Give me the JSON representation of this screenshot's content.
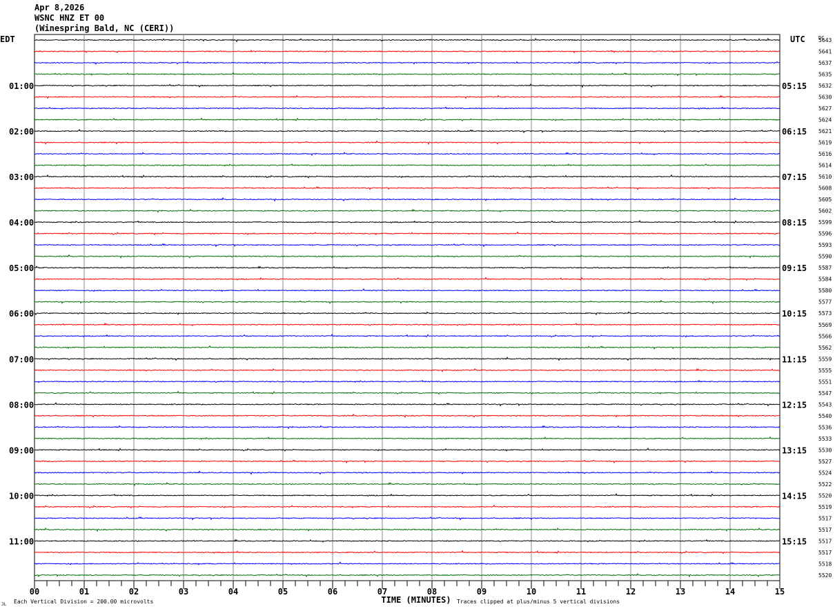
{
  "header": {
    "date": "Apr 8,2026",
    "station": "WSNC HNZ ET 00",
    "location": "(Winespring Bald, NC (CERI))"
  },
  "chart_data": {
    "type": "line",
    "title": "WSNC HNZ ET 00",
    "left_axis_label": "EDT",
    "right_axis_label": "UTC",
    "dc_label": "DC",
    "xlabel": "TIME (MINUTES)",
    "xlim": [
      0,
      15
    ],
    "x_ticks": [
      "00",
      "01",
      "02",
      "03",
      "04",
      "05",
      "06",
      "07",
      "08",
      "09",
      "10",
      "11",
      "12",
      "13",
      "14",
      "15"
    ],
    "left_hour_labels": [
      "01:00",
      "02:00",
      "03:00",
      "04:00",
      "05:00",
      "06:00",
      "07:00",
      "08:00",
      "09:00",
      "10:00",
      "11:00"
    ],
    "right_hour_labels": [
      "05:15",
      "06:15",
      "07:15",
      "08:15",
      "09:15",
      "10:15",
      "11:15",
      "12:15",
      "13:15",
      "14:15",
      "15:15"
    ],
    "trace_colors": [
      "#000000",
      "#ff0000",
      "#0000ff",
      "#007000"
    ],
    "trace_minutes": 15,
    "dc_offsets": [
      5643,
      5641,
      5637,
      5635,
      5632,
      5630,
      5627,
      5624,
      5621,
      5619,
      5616,
      5614,
      5610,
      5608,
      5605,
      5602,
      5599,
      5596,
      5593,
      5590,
      5587,
      5584,
      5580,
      5577,
      5573,
      5569,
      5566,
      5562,
      5559,
      5555,
      5551,
      5547,
      5543,
      5540,
      5536,
      5533,
      5530,
      5527,
      5524,
      5522,
      5520,
      5519,
      5517,
      5517,
      5517,
      5517,
      5518,
      5520
    ],
    "scale_note": "Each Vertical Division =  200.00 microvolts",
    "clip_note": "Traces clipped at plus/minus 5 vertical divisions",
    "corner_mark": "JL"
  }
}
